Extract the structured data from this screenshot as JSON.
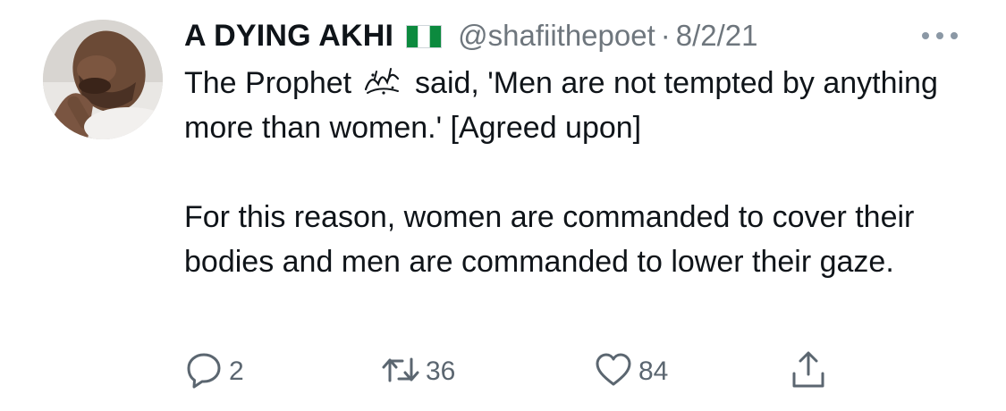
{
  "user": {
    "display_name": "A DYING AKHI",
    "flag_icon": "nigeria-flag-icon",
    "handle": "@shafiithepoet",
    "separator": "·",
    "date": "8/2/21"
  },
  "tweet": {
    "line1_before": "The Prophet",
    "honorific_icon": "salawat-ligature-icon",
    "line1_after": "said, 'Men are not tempted by anything more than women.' [Agreed upon]",
    "paragraph2": "For this reason, women are commanded to cover their bodies and men are commanded to lower their gaze."
  },
  "actions": {
    "reply": {
      "icon": "reply-icon",
      "count": "2"
    },
    "retweet": {
      "icon": "retweet-icon",
      "count": "36"
    },
    "like": {
      "icon": "heart-icon",
      "count": "84"
    },
    "share": {
      "icon": "share-icon"
    }
  },
  "colors": {
    "text": "#0f1419",
    "muted": "#6e767d",
    "icon": "#5b6670",
    "flag_green": "#0c8a3e"
  }
}
